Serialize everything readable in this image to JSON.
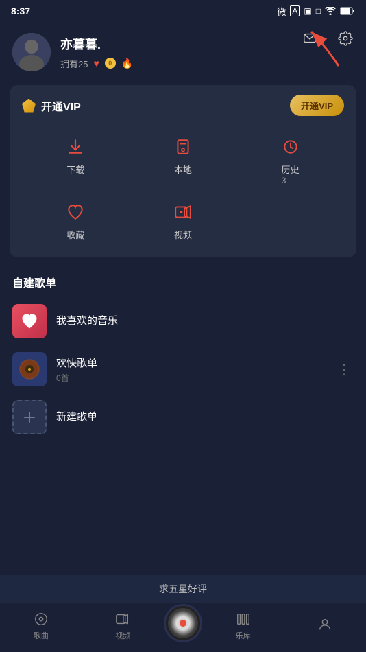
{
  "statusBar": {
    "time": "8:37",
    "icons": [
      "weibo",
      "a-icon",
      "square",
      "square2"
    ]
  },
  "topIcons": {
    "message_label": "消息",
    "settings_label": "设置"
  },
  "profile": {
    "name": "亦暮暮.",
    "fans_label": "拥有",
    "fans_count": "25",
    "coins": "0"
  },
  "vip": {
    "title": "开通VIP",
    "button_label": "开通VIP",
    "diamond_icon": "diamond-icon"
  },
  "functions": [
    {
      "label": "下载",
      "count": "",
      "icon": "download-icon"
    },
    {
      "label": "本地",
      "count": "",
      "icon": "local-icon"
    },
    {
      "label": "历史",
      "count": "3",
      "icon": "history-icon"
    },
    {
      "label": "收藏",
      "count": "",
      "icon": "favorite-icon"
    },
    {
      "label": "视频",
      "count": "",
      "icon": "video-icon"
    }
  ],
  "sectionTitle": "自建歌单",
  "playlists": [
    {
      "name": "我喜欢的音乐",
      "count": "",
      "type": "heart"
    },
    {
      "name": "欢快歌单",
      "count": "0首",
      "type": "art"
    }
  ],
  "addPlaylist": {
    "label": "新建歌单"
  },
  "bottomBanner": {
    "text": "求五星好评"
  },
  "bottomNav": {
    "items": [
      {
        "label": "歌曲",
        "icon": "music-icon",
        "active": false
      },
      {
        "label": "视频",
        "icon": "video-nav-icon",
        "active": false
      },
      {
        "label": "",
        "icon": "center-play-icon",
        "active": false,
        "center": true
      },
      {
        "label": "乐库",
        "icon": "library-icon",
        "active": false
      },
      {
        "label": "",
        "icon": "user-nav-icon",
        "active": false
      }
    ]
  }
}
